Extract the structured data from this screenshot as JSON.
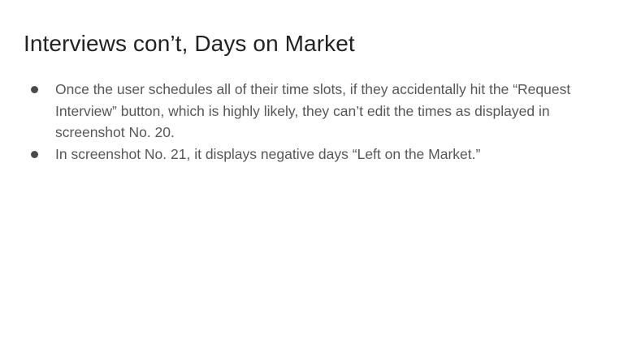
{
  "slide": {
    "title": "Interviews con’t, Days on Market",
    "bullets": [
      "Once the user schedules all of their time slots, if they accidentally hit the “Request Interview” button, which is highly likely, they can’t edit the times as displayed in screenshot No. 20.",
      "In screenshot No. 21, it displays negative days “Left on the Market.”"
    ]
  },
  "colors": {
    "background": "#ffffff",
    "title": "#222222",
    "body_text": "#575757",
    "bullet": "#4a4a4a"
  }
}
